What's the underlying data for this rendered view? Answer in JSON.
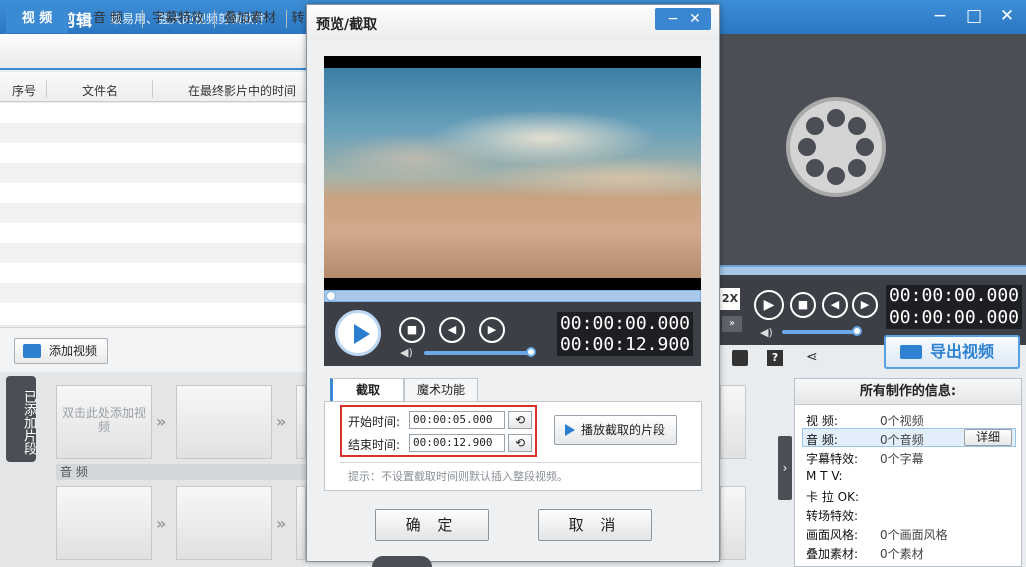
{
  "app": {
    "name": "爱剪辑",
    "slogan": "最易用、强大的视频剪辑软件"
  },
  "window_controls": {
    "minimize": "−",
    "maximize": "□",
    "close": "✕"
  },
  "tabs": [
    {
      "label": "视 频",
      "active": true
    },
    {
      "label": "音 频"
    },
    {
      "label": "字幕特效"
    },
    {
      "label": "叠加素材"
    },
    {
      "label": "转"
    }
  ],
  "table": {
    "columns": [
      "序号",
      "文件名",
      "在最终影片中的时间"
    ]
  },
  "add_video_label": "添加视频",
  "timeline": {
    "side_tab": "已添加片段",
    "slot_hint": "双击此处添加视频",
    "audio_label": "音 频"
  },
  "right_player": {
    "speed": "2X",
    "time_current": "00:00:00.000",
    "time_total": "00:00:00.000"
  },
  "export_label": "导出视频",
  "info_panel": {
    "title": "所有制作的信息:",
    "rows": [
      {
        "key": "视    频:",
        "value": "0个视频"
      },
      {
        "key": "音    频:",
        "value": "0个音频"
      },
      {
        "key": "字幕特效:",
        "value": "0个字幕"
      },
      {
        "key": "M  T  V:",
        "value": ""
      },
      {
        "key": "卡 拉 OK:",
        "value": ""
      },
      {
        "key": "转场特效:",
        "value": ""
      },
      {
        "key": "画面风格:",
        "value": "0个画面风格"
      },
      {
        "key": "叠加素材:",
        "value": "0个素材"
      }
    ],
    "detail_button": "详细"
  },
  "dialog": {
    "title": "预览/截取",
    "time_current": "00:00:00.000",
    "time_total": "00:00:12.900",
    "tabs": [
      "截取",
      "魔术功能"
    ],
    "start_label": "开始时间:",
    "start_value": "00:00:05.000",
    "end_label": "结束时间:",
    "end_value": "00:00:12.900",
    "play_segment": "播放截取的片段",
    "hint": "提示：不设置截取时间则默认插入整段视频。",
    "ok": "确 定",
    "cancel": "取 消"
  },
  "colors": {
    "accent": "#3b8ad4",
    "highlight_box": "#d9322a"
  }
}
